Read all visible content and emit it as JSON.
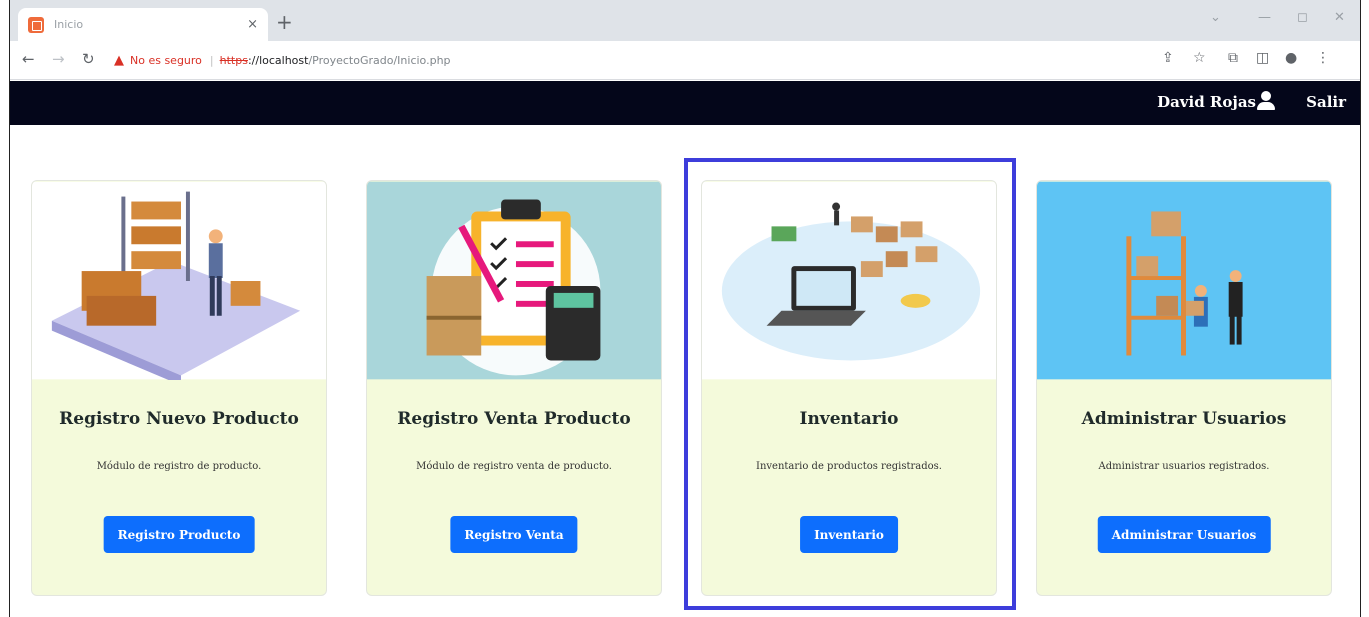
{
  "browser": {
    "tab_title": "Inicio",
    "tab_close": "×",
    "new_tab": "+",
    "address": {
      "warning": "No es seguro",
      "protocol": "https",
      "host": "://localhost",
      "path": "/ProyectoGrado/Inicio.php"
    }
  },
  "navbar": {
    "user_name": "David Rojas",
    "logout_label": "Salir"
  },
  "cards": [
    {
      "title": "Registro Nuevo Producto",
      "text": "Módulo de registro de producto.",
      "button": "Registro Producto",
      "image_bg": "#ffffff"
    },
    {
      "title": "Registro Venta Producto",
      "text": "Módulo de registro venta de producto.",
      "button": "Registro Venta",
      "image_bg": "#a9d6da"
    },
    {
      "title": "Inventario",
      "text": "Inventario de productos registrados.",
      "button": "Inventario",
      "image_bg": "#ffffff"
    },
    {
      "title": "Administrar Usuarios",
      "text": "Administrar usuarios registrados.",
      "button": "Administrar Usuarios",
      "image_bg": "#5ec4f4"
    }
  ],
  "colors": {
    "navbar_bg": "#04061a",
    "card_bg": "#f4fadb",
    "button_bg": "#0d6efd",
    "highlight_border": "#3d3ddb"
  },
  "icons": [
    "warning-icon",
    "user-icon",
    "back-arrow-icon",
    "forward-arrow-icon",
    "reload-icon",
    "share-icon",
    "star-icon",
    "extensions-icon",
    "sidepanel-icon",
    "profile-icon",
    "menu-icon"
  ]
}
